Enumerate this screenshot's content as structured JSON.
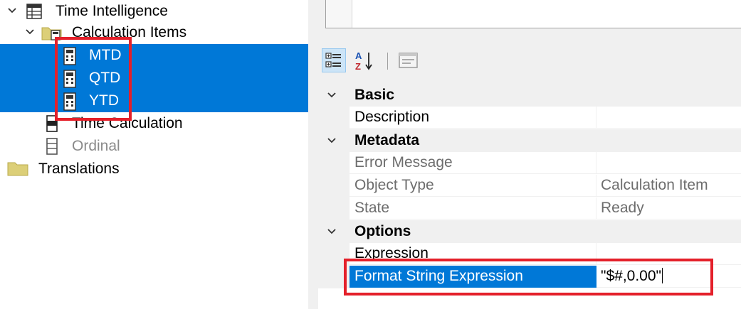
{
  "tree": {
    "items": [
      {
        "label": "Time Intelligence"
      },
      {
        "label": "Calculation Items"
      },
      {
        "label": "MTD"
      },
      {
        "label": "QTD"
      },
      {
        "label": "YTD"
      },
      {
        "label": "Time Calculation"
      },
      {
        "label": "Ordinal"
      },
      {
        "label": "Translations"
      }
    ]
  },
  "properties": {
    "categories": [
      {
        "label": "Basic"
      },
      {
        "label": "Metadata"
      },
      {
        "label": "Options"
      }
    ],
    "rows": [
      {
        "name": "Description",
        "value": ""
      },
      {
        "name": "Error Message",
        "value": ""
      },
      {
        "name": "Object Type",
        "value": "Calculation Item"
      },
      {
        "name": "State",
        "value": "Ready"
      },
      {
        "name": "Expression",
        "value": ""
      },
      {
        "name": "Format String Expression",
        "value": "\"$#,0.00\""
      }
    ]
  },
  "colors": {
    "selection": "#0078d7",
    "highlight_box": "#e4202a",
    "folder": "#dccf78"
  }
}
